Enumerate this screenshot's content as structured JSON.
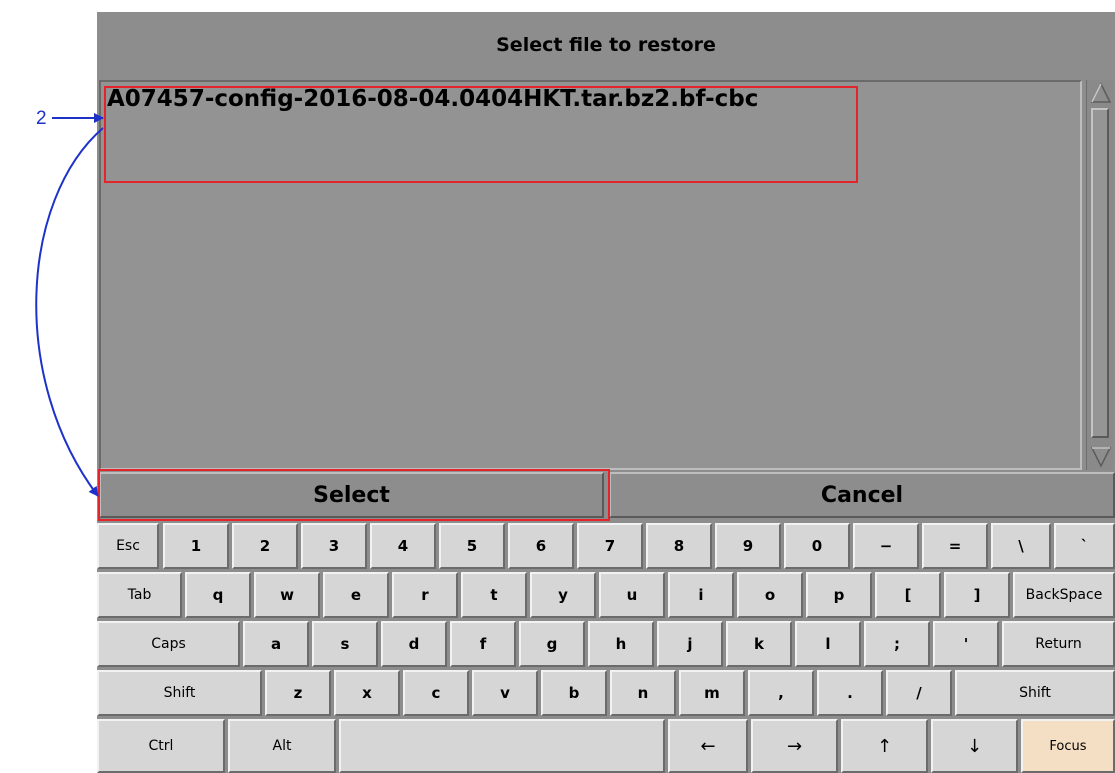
{
  "dialog": {
    "title": "Select file to restore",
    "files": [
      "A07457-config-2016-08-04.0404HKT.tar.bz2.bf-cbc"
    ],
    "buttons": {
      "select": "Select",
      "cancel": "Cancel"
    }
  },
  "keyboard": {
    "row1": [
      "Esc",
      "1",
      "2",
      "3",
      "4",
      "5",
      "6",
      "7",
      "8",
      "9",
      "0",
      "−",
      "=",
      "\\",
      "`"
    ],
    "row2": [
      "Tab",
      "q",
      "w",
      "e",
      "r",
      "t",
      "y",
      "u",
      "i",
      "o",
      "p",
      "[",
      "]",
      "BackSpace"
    ],
    "row3": [
      "Caps",
      "a",
      "s",
      "d",
      "f",
      "g",
      "h",
      "j",
      "k",
      "l",
      ";",
      "'",
      "Return"
    ],
    "row4": [
      "Shift",
      "z",
      "x",
      "c",
      "v",
      "b",
      "n",
      "m",
      ",",
      ".",
      "/",
      "Shift"
    ],
    "row5": [
      "Ctrl",
      "Alt",
      "",
      "←",
      "→",
      "↑",
      "↓",
      "Focus"
    ]
  },
  "annotation": {
    "step_label": "2",
    "highlight_color": "#e3242b",
    "arrow_color": "#1d32c9"
  }
}
